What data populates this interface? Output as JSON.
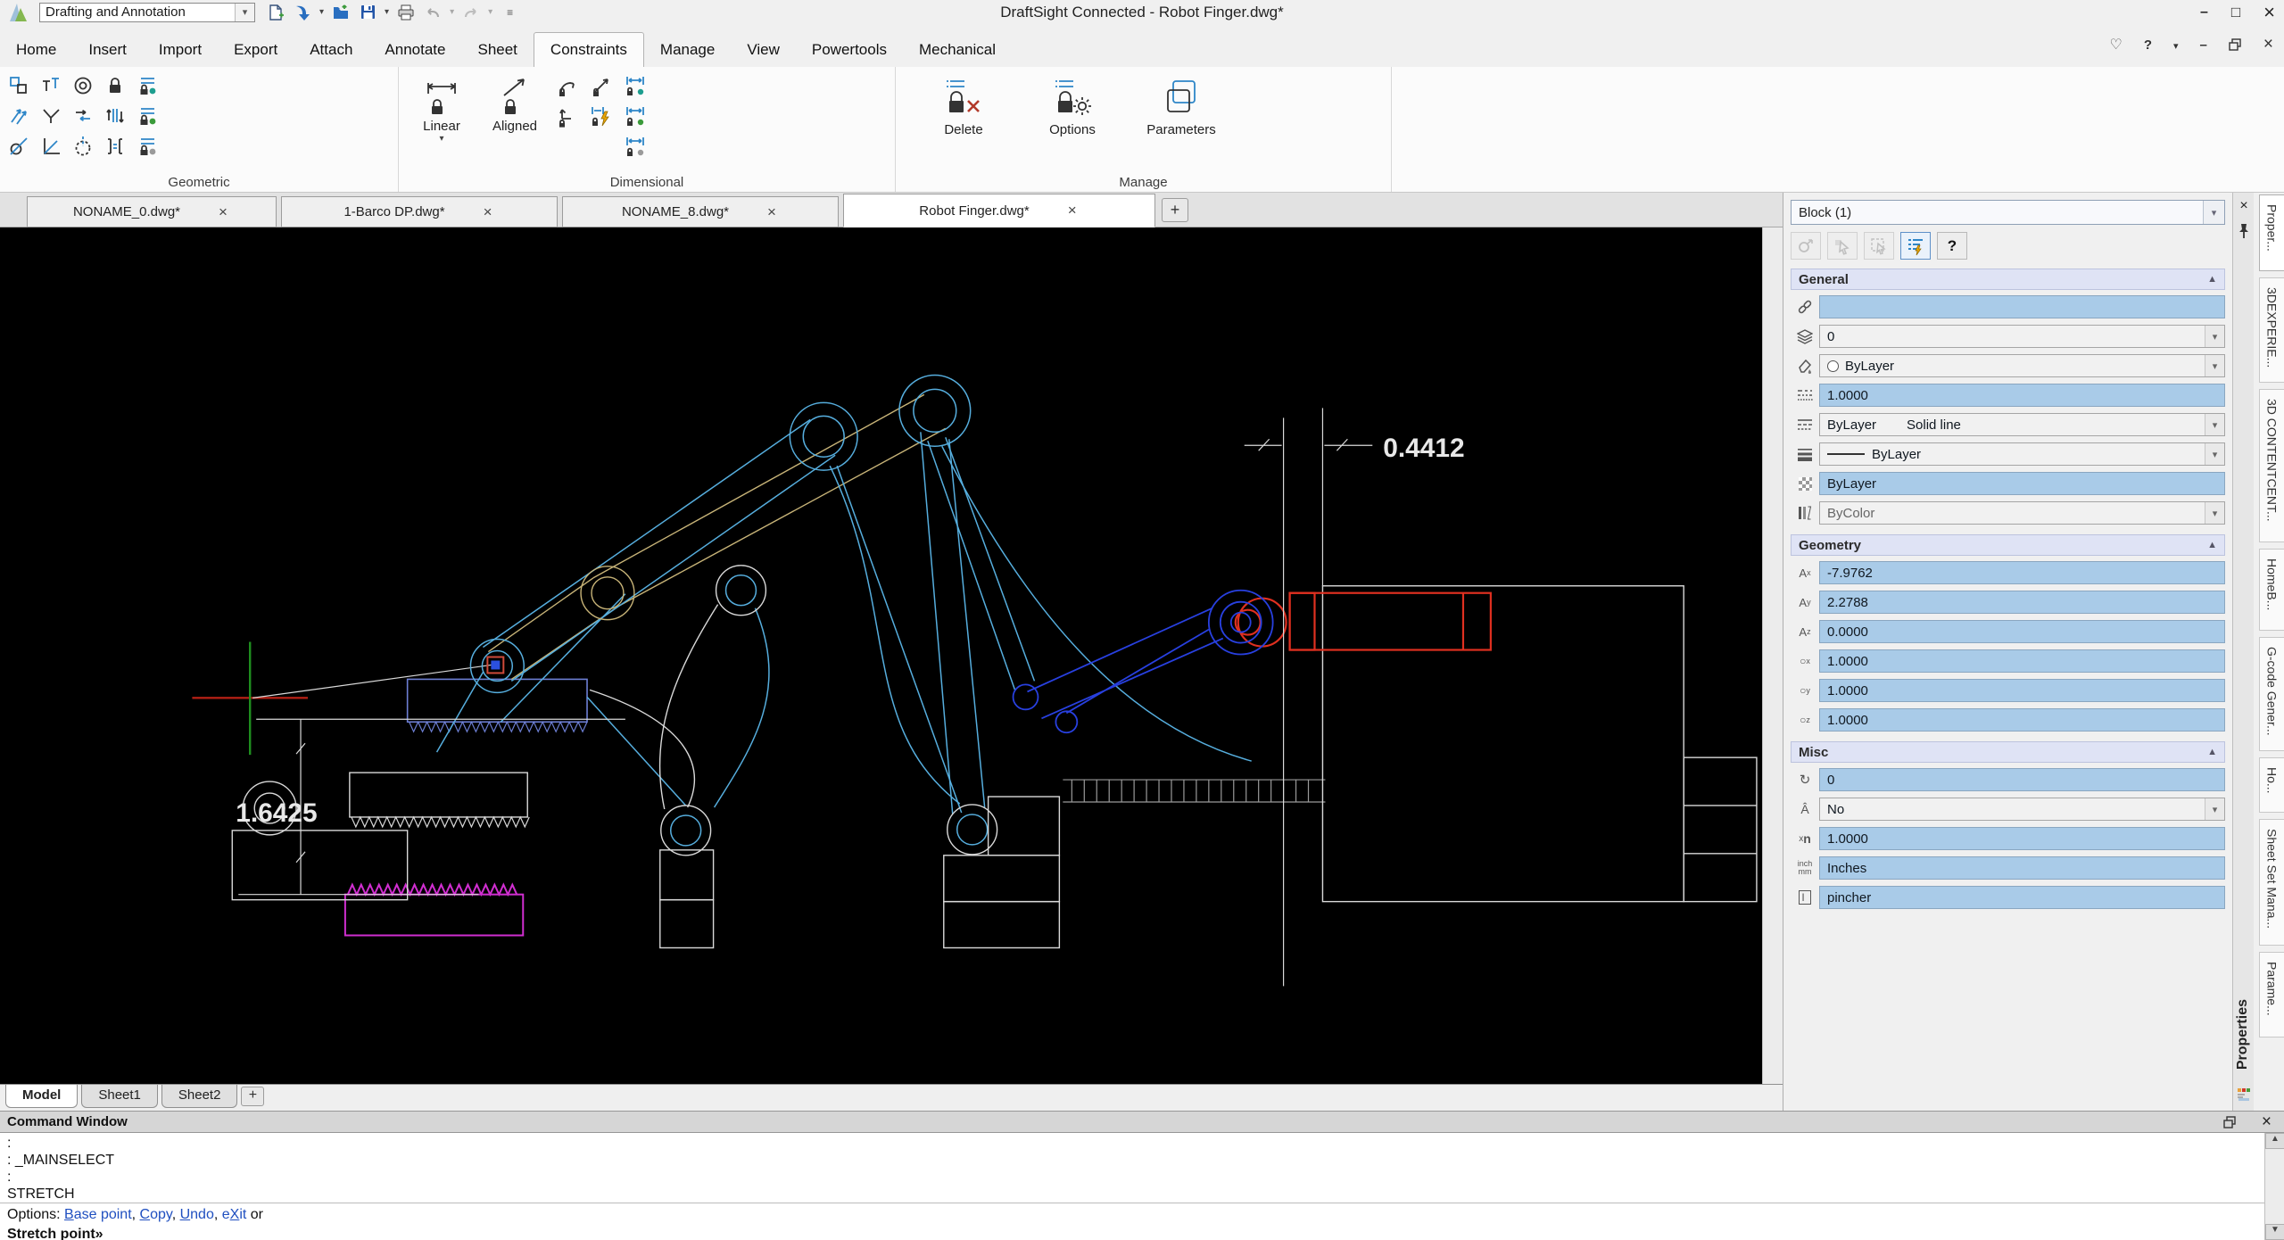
{
  "titlebar": {
    "workspace_selector": "Drafting and Annotation",
    "window_title": "DraftSight Connected - Robot Finger.dwg*"
  },
  "menubar": {
    "items": [
      "Home",
      "Insert",
      "Import",
      "Export",
      "Attach",
      "Annotate",
      "Sheet",
      "Constraints",
      "Manage",
      "View",
      "Powertools",
      "Mechanical"
    ]
  },
  "ribbon": {
    "groups": {
      "geometric_label": "Geometric",
      "dimensional_label": "Dimensional",
      "manage_label": "Manage"
    },
    "buttons": {
      "linear": "Linear",
      "aligned": "Aligned",
      "delete": "Delete",
      "options": "Options",
      "parameters": "Parameters"
    }
  },
  "document_tabs": {
    "tab1": "NONAME_0.dwg*",
    "tab2": "1-Barco DP.dwg*",
    "tab3": "NONAME_8.dwg*",
    "tab4": "Robot Finger.dwg*",
    "add_tab": "+"
  },
  "canvas": {
    "dim_vertical": "1.6425",
    "dim_horizontal": "0.4412"
  },
  "properties_panel": {
    "selection": "Block (1)",
    "help_label": "?",
    "title": "Properties",
    "sections": {
      "general": "General",
      "geometry": "Geometry",
      "misc": "Misc"
    },
    "general": {
      "hyperlink": "",
      "layer": "0",
      "line_color": "ByLayer",
      "line_scale": "1.0000",
      "line_style": "ByLayer",
      "line_style_name": "Solid line",
      "line_weight": "ByLayer",
      "transparency": "ByLayer",
      "print_style": "ByColor"
    },
    "geometry": {
      "position_x": "-7.9762",
      "position_y": "2.2788",
      "position_z": "0.0000",
      "scale_x": "1.0000",
      "scale_y": "1.0000",
      "scale_z": "1.0000"
    },
    "misc": {
      "rotation": "0",
      "annotative": "No",
      "unit_factor": "1.0000",
      "units": "Inches",
      "name": "pincher"
    }
  },
  "right_rail": {
    "tab1": "Proper...",
    "tab2": "3DEXPERIE...",
    "tab3": "3D CONTENTCENT...",
    "tab4": "HomeB...",
    "tab5": "G-code Gener...",
    "tab6": "Ho...",
    "tab7": "Sheet Set Mana...",
    "tab8": "Parame..."
  },
  "sheet_tabs": {
    "model": "Model",
    "sheet1": "Sheet1",
    "sheet2": "Sheet2",
    "add": "+"
  },
  "command_window": {
    "title": "Command Window",
    "line1": ":",
    "line2": ": _MAINSELECT",
    "line3": ":",
    "line4": "STRETCH",
    "options_label": "Options: ",
    "opt1_hot": "B",
    "opt1_rest": "ase point",
    "sep1": ", ",
    "opt2_hot": "C",
    "opt2_rest": "opy",
    "sep2": ", ",
    "opt3_hot": "U",
    "opt3_rest": "ndo",
    "sep3": ", ",
    "opt4_pre": "e",
    "opt4_hot": "X",
    "opt4_rest": "it",
    "options_suffix": " or",
    "prompt": "Stretch point»"
  }
}
